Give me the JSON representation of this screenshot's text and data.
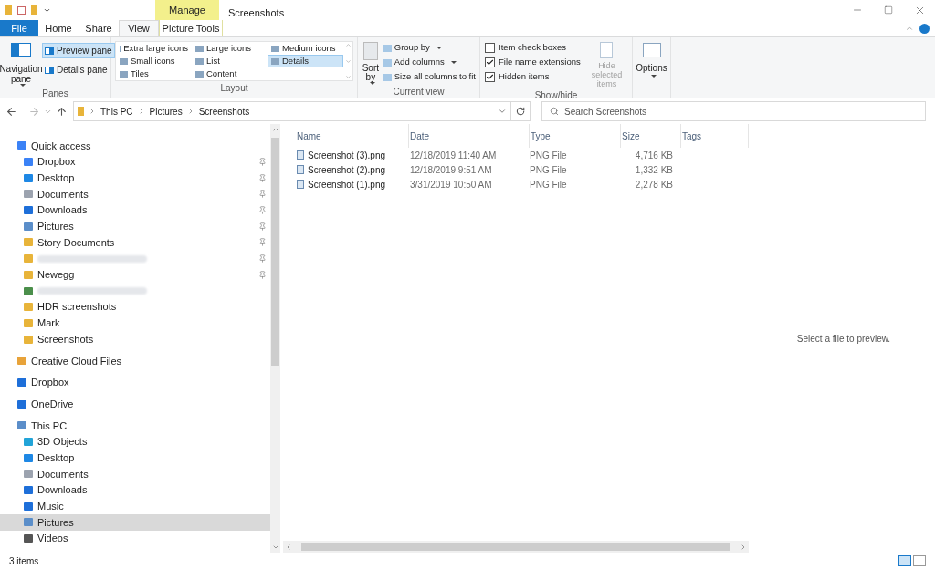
{
  "window": {
    "title": "Screenshots",
    "context_tab": "Manage"
  },
  "tabs": [
    {
      "label": "File",
      "kind": "file",
      "selected": false
    },
    {
      "label": "Home",
      "kind": "tab",
      "selected": false
    },
    {
      "label": "Share",
      "kind": "tab",
      "selected": false
    },
    {
      "label": "View",
      "kind": "tab",
      "selected": true
    },
    {
      "label": "Picture Tools",
      "kind": "context",
      "selected": false
    }
  ],
  "ribbon": {
    "panes": {
      "label": "Panes",
      "navigation_pane": "Navigation pane",
      "buttons": [
        {
          "label": "Preview pane",
          "selected": true
        },
        {
          "label": "Details pane",
          "selected": false
        }
      ]
    },
    "layout": {
      "label": "Layout",
      "items": [
        {
          "label": "Extra large icons",
          "selected": false
        },
        {
          "label": "Small icons",
          "selected": false
        },
        {
          "label": "Tiles",
          "selected": false
        },
        {
          "label": "Large icons",
          "selected": false
        },
        {
          "label": "List",
          "selected": false
        },
        {
          "label": "Content",
          "selected": false
        },
        {
          "label": "Medium icons",
          "selected": false
        },
        {
          "label": "Details",
          "selected": true
        }
      ]
    },
    "current_view": {
      "label": "Current view",
      "sort_by": "Sort by",
      "items": [
        "Group by",
        "Add columns",
        "Size all columns to fit"
      ]
    },
    "show_hide": {
      "label": "Show/hide",
      "checkboxes": [
        {
          "label": "Item check boxes",
          "checked": false
        },
        {
          "label": "File name extensions",
          "checked": true
        },
        {
          "label": "Hidden items",
          "checked": true
        }
      ],
      "hide_selected": {
        "label": "Hide selected items",
        "disabled": true
      }
    },
    "options": {
      "label": "Options"
    }
  },
  "address": {
    "path": [
      "This PC",
      "Pictures",
      "Screenshots"
    ],
    "search_placeholder": "Search Screenshots"
  },
  "navigation": [
    {
      "label": "Quick access",
      "selected": false,
      "children": [
        {
          "label": "Dropbox",
          "pinned": true,
          "redacted": false,
          "selected": false
        },
        {
          "label": "Desktop",
          "pinned": true,
          "redacted": false,
          "selected": false
        },
        {
          "label": "Documents",
          "pinned": true,
          "redacted": false,
          "selected": false
        },
        {
          "label": "Downloads",
          "pinned": true,
          "redacted": false,
          "selected": false
        },
        {
          "label": "Pictures",
          "pinned": true,
          "redacted": false,
          "selected": false
        },
        {
          "label": "Story Documents",
          "pinned": true,
          "redacted": false,
          "selected": false
        },
        {
          "pinned": true,
          "redacted": true,
          "selected": false
        },
        {
          "label": "Newegg",
          "pinned": true,
          "redacted": false,
          "selected": false
        },
        {
          "pinned": false,
          "redacted": true,
          "selected": false
        },
        {
          "label": "HDR screenshots",
          "pinned": false,
          "redacted": false,
          "selected": false
        },
        {
          "label": "Mark",
          "pinned": false,
          "redacted": false,
          "selected": false
        },
        {
          "label": "Screenshots",
          "pinned": false,
          "redacted": false,
          "selected": false
        }
      ]
    },
    {
      "label": "Creative Cloud Files",
      "selected": false
    },
    {
      "label": "Dropbox",
      "selected": false
    },
    {
      "label": "OneDrive",
      "selected": false
    },
    {
      "label": "This PC",
      "selected": false,
      "children": [
        {
          "label": "3D Objects",
          "pinned": false,
          "redacted": false,
          "selected": false
        },
        {
          "label": "Desktop",
          "pinned": false,
          "redacted": false,
          "selected": false
        },
        {
          "label": "Documents",
          "pinned": false,
          "redacted": false,
          "selected": false
        },
        {
          "label": "Downloads",
          "pinned": false,
          "redacted": false,
          "selected": false
        },
        {
          "label": "Music",
          "pinned": false,
          "redacted": false,
          "selected": false
        },
        {
          "label": "Pictures",
          "pinned": false,
          "redacted": false,
          "selected": true
        },
        {
          "label": "Videos",
          "pinned": false,
          "redacted": false,
          "selected": false
        }
      ]
    }
  ],
  "table": {
    "columns": [
      "Name",
      "Date",
      "Type",
      "Size",
      "Tags"
    ],
    "rows": [
      {
        "name": "Screenshot (3).png",
        "date": "12/18/2019 11:40 AM",
        "type": "PNG File",
        "size": "4,716 KB"
      },
      {
        "name": "Screenshot (2).png",
        "date": "12/18/2019 9:51 AM",
        "type": "PNG File",
        "size": "1,332 KB"
      },
      {
        "name": "Screenshot (1).png",
        "date": "3/31/2019 10:50 AM",
        "type": "PNG File",
        "size": "2,278 KB"
      }
    ]
  },
  "preview": {
    "message": "Select a file to preview."
  },
  "status_bar": {
    "count": "3 items"
  }
}
